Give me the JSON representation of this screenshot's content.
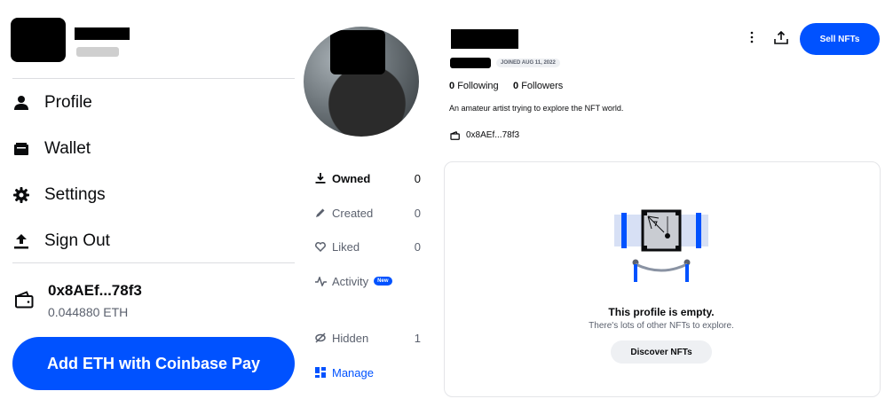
{
  "sidebar": {
    "menu": [
      {
        "label": "Profile",
        "icon": "person-icon"
      },
      {
        "label": "Wallet",
        "icon": "wallet-icon"
      },
      {
        "label": "Settings",
        "icon": "gear-icon"
      },
      {
        "label": "Sign Out",
        "icon": "sign-out-icon"
      }
    ],
    "wallet_address": "0x8AEf...78f3",
    "wallet_balance": "0.044880 ETH",
    "add_eth_button": "Add ETH with Coinbase Pay"
  },
  "profile": {
    "joined": "JOINED AUG 11, 2022",
    "following_count": "0",
    "following_label": "Following",
    "followers_count": "0",
    "followers_label": "Followers",
    "bio": "An amateur artist trying to explore the NFT world.",
    "address": "0x8AEf...78f3",
    "sell_button": "Sell NFTs",
    "more_icon": "more-vertical-icon",
    "share_icon": "share-upload-icon"
  },
  "tabs": [
    {
      "label": "Owned",
      "count": "0",
      "icon": "download-icon"
    },
    {
      "label": "Created",
      "count": "0",
      "icon": "pencil-icon"
    },
    {
      "label": "Liked",
      "count": "0",
      "icon": "heart-icon"
    },
    {
      "label": "Activity",
      "badge": "New",
      "icon": "activity-icon"
    },
    {
      "label": "Hidden",
      "count": "1",
      "icon": "hidden-icon"
    },
    {
      "label": "Manage",
      "icon": "grid-icon"
    }
  ],
  "empty_state": {
    "title": "This profile is empty.",
    "subtitle": "There's lots of other NFTs to explore.",
    "button": "Discover NFTs"
  },
  "colors": {
    "accent": "#0052ff",
    "muted": "#5b616e",
    "border": "#e4e5e8"
  }
}
